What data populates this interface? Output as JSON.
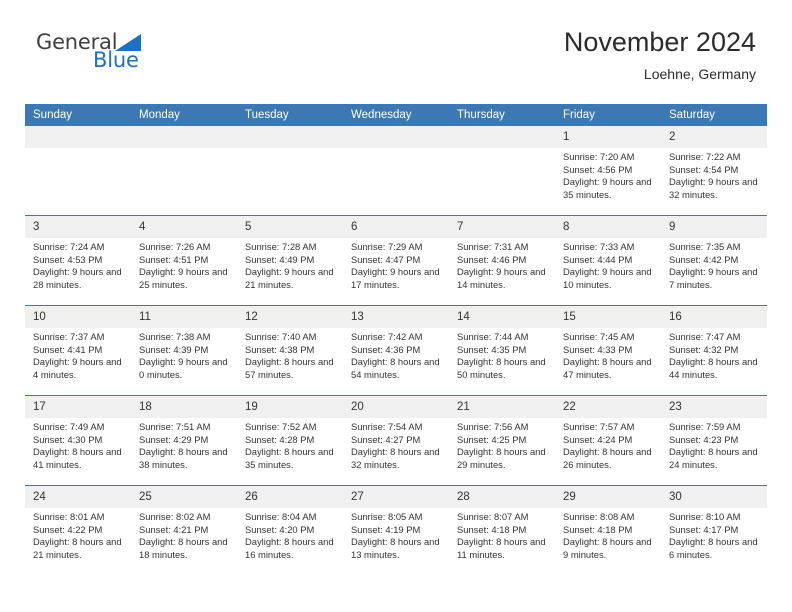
{
  "brand": {
    "name_top": "General",
    "name_bottom": "Blue",
    "triangle_icon": "triangle-icon",
    "color_text": "#3f3f3f",
    "color_blue": "#1f6fc4"
  },
  "header": {
    "title": "November 2024",
    "subtitle": "Loehne, Germany"
  },
  "theme": {
    "header_blue": "#3c78b4",
    "daystrip_gray": "#f0f0f0",
    "text": "#333333"
  },
  "weekday_headers": [
    "Sunday",
    "Monday",
    "Tuesday",
    "Wednesday",
    "Thursday",
    "Friday",
    "Saturday"
  ],
  "labels": {
    "sunrise": "Sunrise:",
    "sunset": "Sunset:",
    "daylight": "Daylight:"
  },
  "weeks": [
    [
      {
        "day": "",
        "empty": true
      },
      {
        "day": "",
        "empty": true
      },
      {
        "day": "",
        "empty": true
      },
      {
        "day": "",
        "empty": true
      },
      {
        "day": "",
        "empty": true
      },
      {
        "day": "1",
        "sunrise": "Sunrise: 7:20 AM",
        "sunset": "Sunset: 4:56 PM",
        "daylight": "Daylight: 9 hours and 35 minutes."
      },
      {
        "day": "2",
        "sunrise": "Sunrise: 7:22 AM",
        "sunset": "Sunset: 4:54 PM",
        "daylight": "Daylight: 9 hours and 32 minutes."
      }
    ],
    [
      {
        "day": "3",
        "sunrise": "Sunrise: 7:24 AM",
        "sunset": "Sunset: 4:53 PM",
        "daylight": "Daylight: 9 hours and 28 minutes."
      },
      {
        "day": "4",
        "sunrise": "Sunrise: 7:26 AM",
        "sunset": "Sunset: 4:51 PM",
        "daylight": "Daylight: 9 hours and 25 minutes."
      },
      {
        "day": "5",
        "sunrise": "Sunrise: 7:28 AM",
        "sunset": "Sunset: 4:49 PM",
        "daylight": "Daylight: 9 hours and 21 minutes."
      },
      {
        "day": "6",
        "sunrise": "Sunrise: 7:29 AM",
        "sunset": "Sunset: 4:47 PM",
        "daylight": "Daylight: 9 hours and 17 minutes."
      },
      {
        "day": "7",
        "sunrise": "Sunrise: 7:31 AM",
        "sunset": "Sunset: 4:46 PM",
        "daylight": "Daylight: 9 hours and 14 minutes."
      },
      {
        "day": "8",
        "sunrise": "Sunrise: 7:33 AM",
        "sunset": "Sunset: 4:44 PM",
        "daylight": "Daylight: 9 hours and 10 minutes."
      },
      {
        "day": "9",
        "sunrise": "Sunrise: 7:35 AM",
        "sunset": "Sunset: 4:42 PM",
        "daylight": "Daylight: 9 hours and 7 minutes."
      }
    ],
    [
      {
        "day": "10",
        "sunrise": "Sunrise: 7:37 AM",
        "sunset": "Sunset: 4:41 PM",
        "daylight": "Daylight: 9 hours and 4 minutes."
      },
      {
        "day": "11",
        "sunrise": "Sunrise: 7:38 AM",
        "sunset": "Sunset: 4:39 PM",
        "daylight": "Daylight: 9 hours and 0 minutes."
      },
      {
        "day": "12",
        "sunrise": "Sunrise: 7:40 AM",
        "sunset": "Sunset: 4:38 PM",
        "daylight": "Daylight: 8 hours and 57 minutes."
      },
      {
        "day": "13",
        "sunrise": "Sunrise: 7:42 AM",
        "sunset": "Sunset: 4:36 PM",
        "daylight": "Daylight: 8 hours and 54 minutes."
      },
      {
        "day": "14",
        "sunrise": "Sunrise: 7:44 AM",
        "sunset": "Sunset: 4:35 PM",
        "daylight": "Daylight: 8 hours and 50 minutes."
      },
      {
        "day": "15",
        "sunrise": "Sunrise: 7:45 AM",
        "sunset": "Sunset: 4:33 PM",
        "daylight": "Daylight: 8 hours and 47 minutes."
      },
      {
        "day": "16",
        "sunrise": "Sunrise: 7:47 AM",
        "sunset": "Sunset: 4:32 PM",
        "daylight": "Daylight: 8 hours and 44 minutes."
      }
    ],
    [
      {
        "day": "17",
        "sunrise": "Sunrise: 7:49 AM",
        "sunset": "Sunset: 4:30 PM",
        "daylight": "Daylight: 8 hours and 41 minutes."
      },
      {
        "day": "18",
        "sunrise": "Sunrise: 7:51 AM",
        "sunset": "Sunset: 4:29 PM",
        "daylight": "Daylight: 8 hours and 38 minutes."
      },
      {
        "day": "19",
        "sunrise": "Sunrise: 7:52 AM",
        "sunset": "Sunset: 4:28 PM",
        "daylight": "Daylight: 8 hours and 35 minutes."
      },
      {
        "day": "20",
        "sunrise": "Sunrise: 7:54 AM",
        "sunset": "Sunset: 4:27 PM",
        "daylight": "Daylight: 8 hours and 32 minutes."
      },
      {
        "day": "21",
        "sunrise": "Sunrise: 7:56 AM",
        "sunset": "Sunset: 4:25 PM",
        "daylight": "Daylight: 8 hours and 29 minutes."
      },
      {
        "day": "22",
        "sunrise": "Sunrise: 7:57 AM",
        "sunset": "Sunset: 4:24 PM",
        "daylight": "Daylight: 8 hours and 26 minutes."
      },
      {
        "day": "23",
        "sunrise": "Sunrise: 7:59 AM",
        "sunset": "Sunset: 4:23 PM",
        "daylight": "Daylight: 8 hours and 24 minutes."
      }
    ],
    [
      {
        "day": "24",
        "sunrise": "Sunrise: 8:01 AM",
        "sunset": "Sunset: 4:22 PM",
        "daylight": "Daylight: 8 hours and 21 minutes."
      },
      {
        "day": "25",
        "sunrise": "Sunrise: 8:02 AM",
        "sunset": "Sunset: 4:21 PM",
        "daylight": "Daylight: 8 hours and 18 minutes."
      },
      {
        "day": "26",
        "sunrise": "Sunrise: 8:04 AM",
        "sunset": "Sunset: 4:20 PM",
        "daylight": "Daylight: 8 hours and 16 minutes."
      },
      {
        "day": "27",
        "sunrise": "Sunrise: 8:05 AM",
        "sunset": "Sunset: 4:19 PM",
        "daylight": "Daylight: 8 hours and 13 minutes."
      },
      {
        "day": "28",
        "sunrise": "Sunrise: 8:07 AM",
        "sunset": "Sunset: 4:18 PM",
        "daylight": "Daylight: 8 hours and 11 minutes."
      },
      {
        "day": "29",
        "sunrise": "Sunrise: 8:08 AM",
        "sunset": "Sunset: 4:18 PM",
        "daylight": "Daylight: 8 hours and 9 minutes."
      },
      {
        "day": "30",
        "sunrise": "Sunrise: 8:10 AM",
        "sunset": "Sunset: 4:17 PM",
        "daylight": "Daylight: 8 hours and 6 minutes."
      }
    ]
  ]
}
